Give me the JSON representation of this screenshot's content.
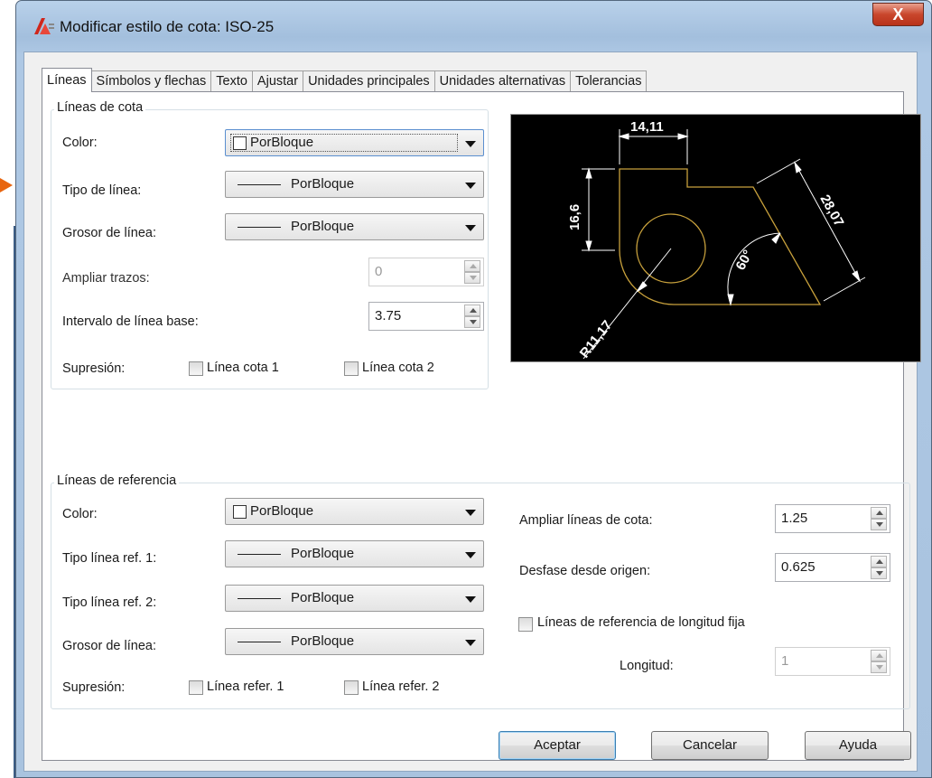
{
  "window": {
    "title": "Modificar estilo de cota: ISO-25",
    "close_label": "X"
  },
  "tabs": [
    "Líneas",
    "Símbolos y flechas",
    "Texto",
    "Ajustar",
    "Unidades principales",
    "Unidades alternativas",
    "Tolerancias"
  ],
  "dim_lines": {
    "group_title": "Líneas de cota",
    "color_label": "Color:",
    "color_value": "PorBloque",
    "linetype_label": "Tipo de línea:",
    "linetype_value": "PorBloque",
    "lineweight_label": "Grosor de línea:",
    "lineweight_value": "PorBloque",
    "extend_label": "Ampliar trazos:",
    "extend_value": "0",
    "baseline_label": "Intervalo de línea base:",
    "baseline_value": "3.75",
    "suppress_label": "Supresión:",
    "suppress_1": "Línea cota 1",
    "suppress_2": "Línea cota 2"
  },
  "preview": {
    "dim_top": "14,11",
    "dim_left": "16,6",
    "dim_right": "28,07",
    "dim_angle": "60°",
    "dim_radius": "R11,17"
  },
  "ext_lines": {
    "group_title": "Líneas de referencia",
    "color_label": "Color:",
    "color_value": "PorBloque",
    "linetype1_label": "Tipo línea ref. 1:",
    "linetype1_value": "PorBloque",
    "linetype2_label": "Tipo línea ref. 2:",
    "linetype2_value": "PorBloque",
    "lineweight_label": "Grosor de línea:",
    "lineweight_value": "PorBloque",
    "suppress_label": "Supresión:",
    "suppress_1": "Línea refer. 1",
    "suppress_2": "Línea refer. 2",
    "extend_label": "Ampliar líneas de cota:",
    "extend_value": "1.25",
    "offset_label": "Desfase desde origen:",
    "offset_value": "0.625",
    "fixed_label": "Líneas de referencia de longitud fija",
    "length_label": "Longitud:",
    "length_value": "1"
  },
  "buttons": {
    "ok": "Aceptar",
    "cancel": "Cancelar",
    "help": "Ayuda"
  },
  "colors": {
    "preview_bg": "#000000",
    "preview_geometry": "#c8a13c",
    "preview_dims": "#ffffff"
  }
}
